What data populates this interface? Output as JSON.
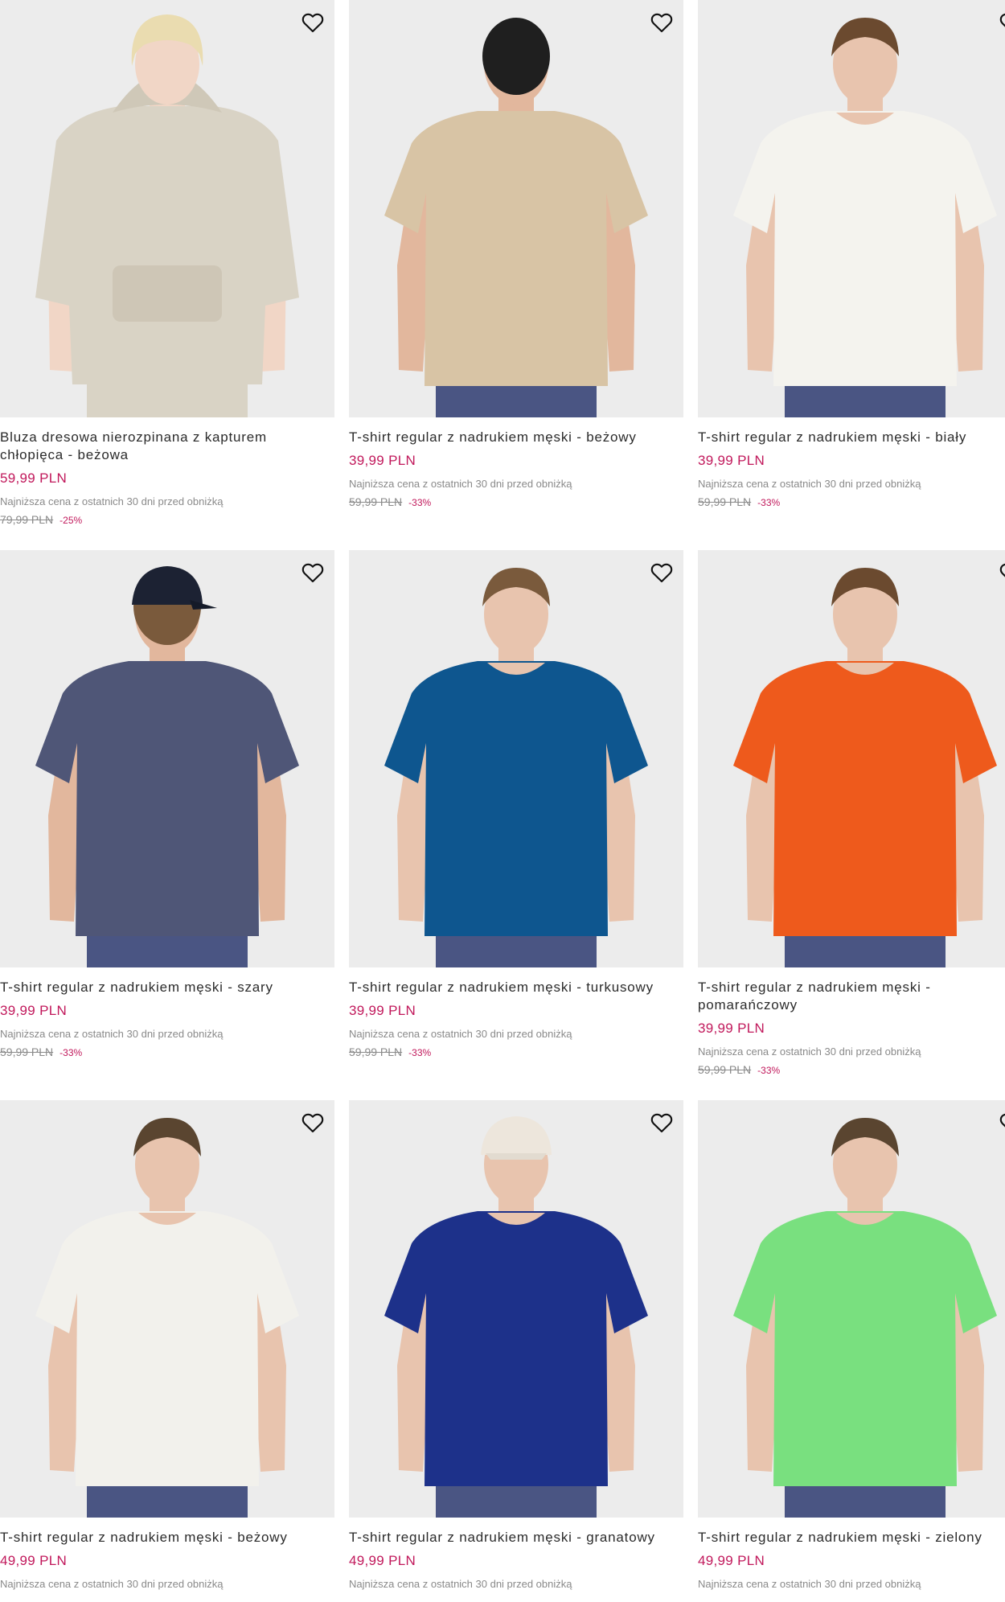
{
  "colors": {
    "price": "#c1185b",
    "muted": "#8a8a8a",
    "image_bg": "#ececec"
  },
  "products": [
    {
      "name": "Bluza dresowa nierozpinana z kapturem chłopięca - beżowa",
      "price": "59,99 PLN",
      "lowest_label": "Najniższa cena z ostatnich 30 dni przed obniżką",
      "old_price": "79,99 PLN",
      "discount": "-25%",
      "garment": "hoodie",
      "garment_color": "#d9d3c5",
      "skin": "#f1d6c6",
      "hair": "#eadcb0",
      "favorite_icon": "heart-outline-icon"
    },
    {
      "name": "T-shirt regular z nadrukiem męski - beżowy",
      "price": "39,99 PLN",
      "lowest_label": "Najniższa cena z ostatnich 30 dni przed obniżką",
      "old_price": "59,99 PLN",
      "discount": "-33%",
      "garment": "tee-back",
      "garment_color": "#d8c4a5",
      "skin": "#e2b79d",
      "hair": "#1f1f1f",
      "favorite_icon": "heart-outline-icon"
    },
    {
      "name": "T-shirt regular z nadrukiem męski - biały",
      "price": "39,99 PLN",
      "lowest_label": "Najniższa cena z ostatnich 30 dni przed obniżką",
      "old_price": "59,99 PLN",
      "discount": "-33%",
      "garment": "tee",
      "garment_color": "#f4f3ee",
      "skin": "#e8c4ae",
      "hair": "#6b4a2f",
      "favorite_icon": "heart-outline-icon"
    },
    {
      "name": "T-shirt regular z nadrukiem męski - szary",
      "price": "39,99 PLN",
      "lowest_label": "Najniższa cena z ostatnich 30 dni przed obniżką",
      "old_price": "59,99 PLN",
      "discount": "-33%",
      "garment": "tee-back-cap",
      "garment_color": "#4f5677",
      "skin": "#e2b79d",
      "hair": "#7a5a3c",
      "favorite_icon": "heart-outline-icon"
    },
    {
      "name": "T-shirt regular z nadrukiem męski - turkusowy",
      "price": "39,99 PLN",
      "lowest_label": "Najniższa cena z ostatnich 30 dni przed obniżką",
      "old_price": "59,99 PLN",
      "discount": "-33%",
      "garment": "tee",
      "garment_color": "#0e568f",
      "skin": "#e8c4ae",
      "hair": "#7a5a3c",
      "favorite_icon": "heart-outline-icon"
    },
    {
      "name": "T-shirt regular z nadrukiem męski - pomarańczowy",
      "price": "39,99 PLN",
      "lowest_label": "Najniższa cena z ostatnich 30 dni przed obniżką",
      "old_price": "59,99 PLN",
      "discount": "-33%",
      "garment": "tee",
      "garment_color": "#ee5a1c",
      "skin": "#e8c4ae",
      "hair": "#6b4a2f",
      "favorite_icon": "heart-outline-icon"
    },
    {
      "name": "T-shirt regular z nadrukiem męski - beżowy",
      "price": "49,99 PLN",
      "lowest_label": "Najniższa cena z ostatnich 30 dni przed obniżką",
      "old_price": "",
      "discount": "",
      "garment": "tee",
      "garment_color": "#f2f1ec",
      "skin": "#e8c4ae",
      "hair": "#5a4530",
      "favorite_icon": "heart-outline-icon"
    },
    {
      "name": "T-shirt regular z nadrukiem męski - granatowy",
      "price": "49,99 PLN",
      "lowest_label": "Najniższa cena z ostatnich 30 dni przed obniżką",
      "old_price": "",
      "discount": "",
      "garment": "tee-cap",
      "garment_color": "#1d318a",
      "skin": "#e8c4ae",
      "hair": "#ede6dc",
      "favorite_icon": "heart-outline-icon"
    },
    {
      "name": "T-shirt regular z nadrukiem męski - zielony",
      "price": "49,99 PLN",
      "lowest_label": "Najniższa cena z ostatnich 30 dni przed obniżką",
      "old_price": "",
      "discount": "",
      "garment": "tee",
      "garment_color": "#79e07f",
      "skin": "#e8c4ae",
      "hair": "#5a4530",
      "favorite_icon": "heart-outline-icon"
    }
  ]
}
